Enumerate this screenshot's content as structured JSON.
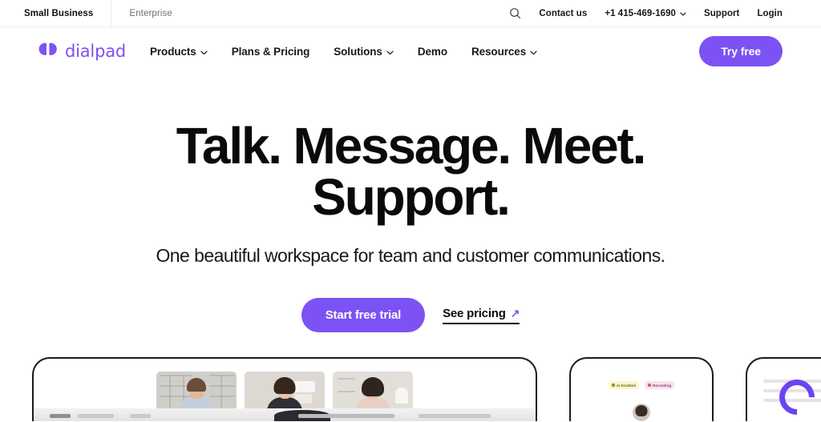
{
  "utility_bar": {
    "tabs": [
      {
        "label": "Small Business",
        "active": true
      },
      {
        "label": "Enterprise",
        "active": false
      }
    ],
    "search_icon": "search-icon",
    "links": [
      {
        "label": "Contact us"
      },
      {
        "label": "+1 415-469-1690",
        "has_chevron": true,
        "chevron": "⌄"
      },
      {
        "label": "Support"
      },
      {
        "label": "Login"
      }
    ]
  },
  "nav": {
    "logo_text": "dialpad",
    "logo_icon": "dialpad-logo-icon",
    "items": [
      {
        "label": "Products",
        "has_chevron": true,
        "chevron": "⌄"
      },
      {
        "label": "Plans & Pricing",
        "has_chevron": false,
        "chevron": ""
      },
      {
        "label": "Solutions",
        "has_chevron": true,
        "chevron": "⌄"
      },
      {
        "label": "Demo",
        "has_chevron": false,
        "chevron": ""
      },
      {
        "label": "Resources",
        "has_chevron": true,
        "chevron": "⌄"
      }
    ],
    "cta_label": "Try free"
  },
  "hero": {
    "title_line_1": "Talk. Message. Meet.",
    "title_line_2": "Support.",
    "subtitle": "One beautiful workspace for team and customer communications.",
    "primary_cta": "Start free trial",
    "secondary_cta": "See pricing",
    "secondary_cta_icon": "↗"
  },
  "product_mock": {
    "meeting_card": {
      "participants": [
        {
          "name": "participant-1"
        },
        {
          "name": "participant-2"
        },
        {
          "name": "participant-3"
        }
      ]
    },
    "ai_card": {
      "badges": [
        {
          "label": "Ai Enabled",
          "icon": "sparkle-icon"
        },
        {
          "label": "Recording",
          "icon": "record-icon"
        }
      ]
    }
  },
  "colors": {
    "brand_purple": "#7c52f4",
    "ring_purple": "#6c43f0",
    "text_dark": "#0a0a0b",
    "text_muted": "#6f7278",
    "badge_ai_bg": "#fbf6cd",
    "badge_recording_bg": "#f8e2ee"
  }
}
